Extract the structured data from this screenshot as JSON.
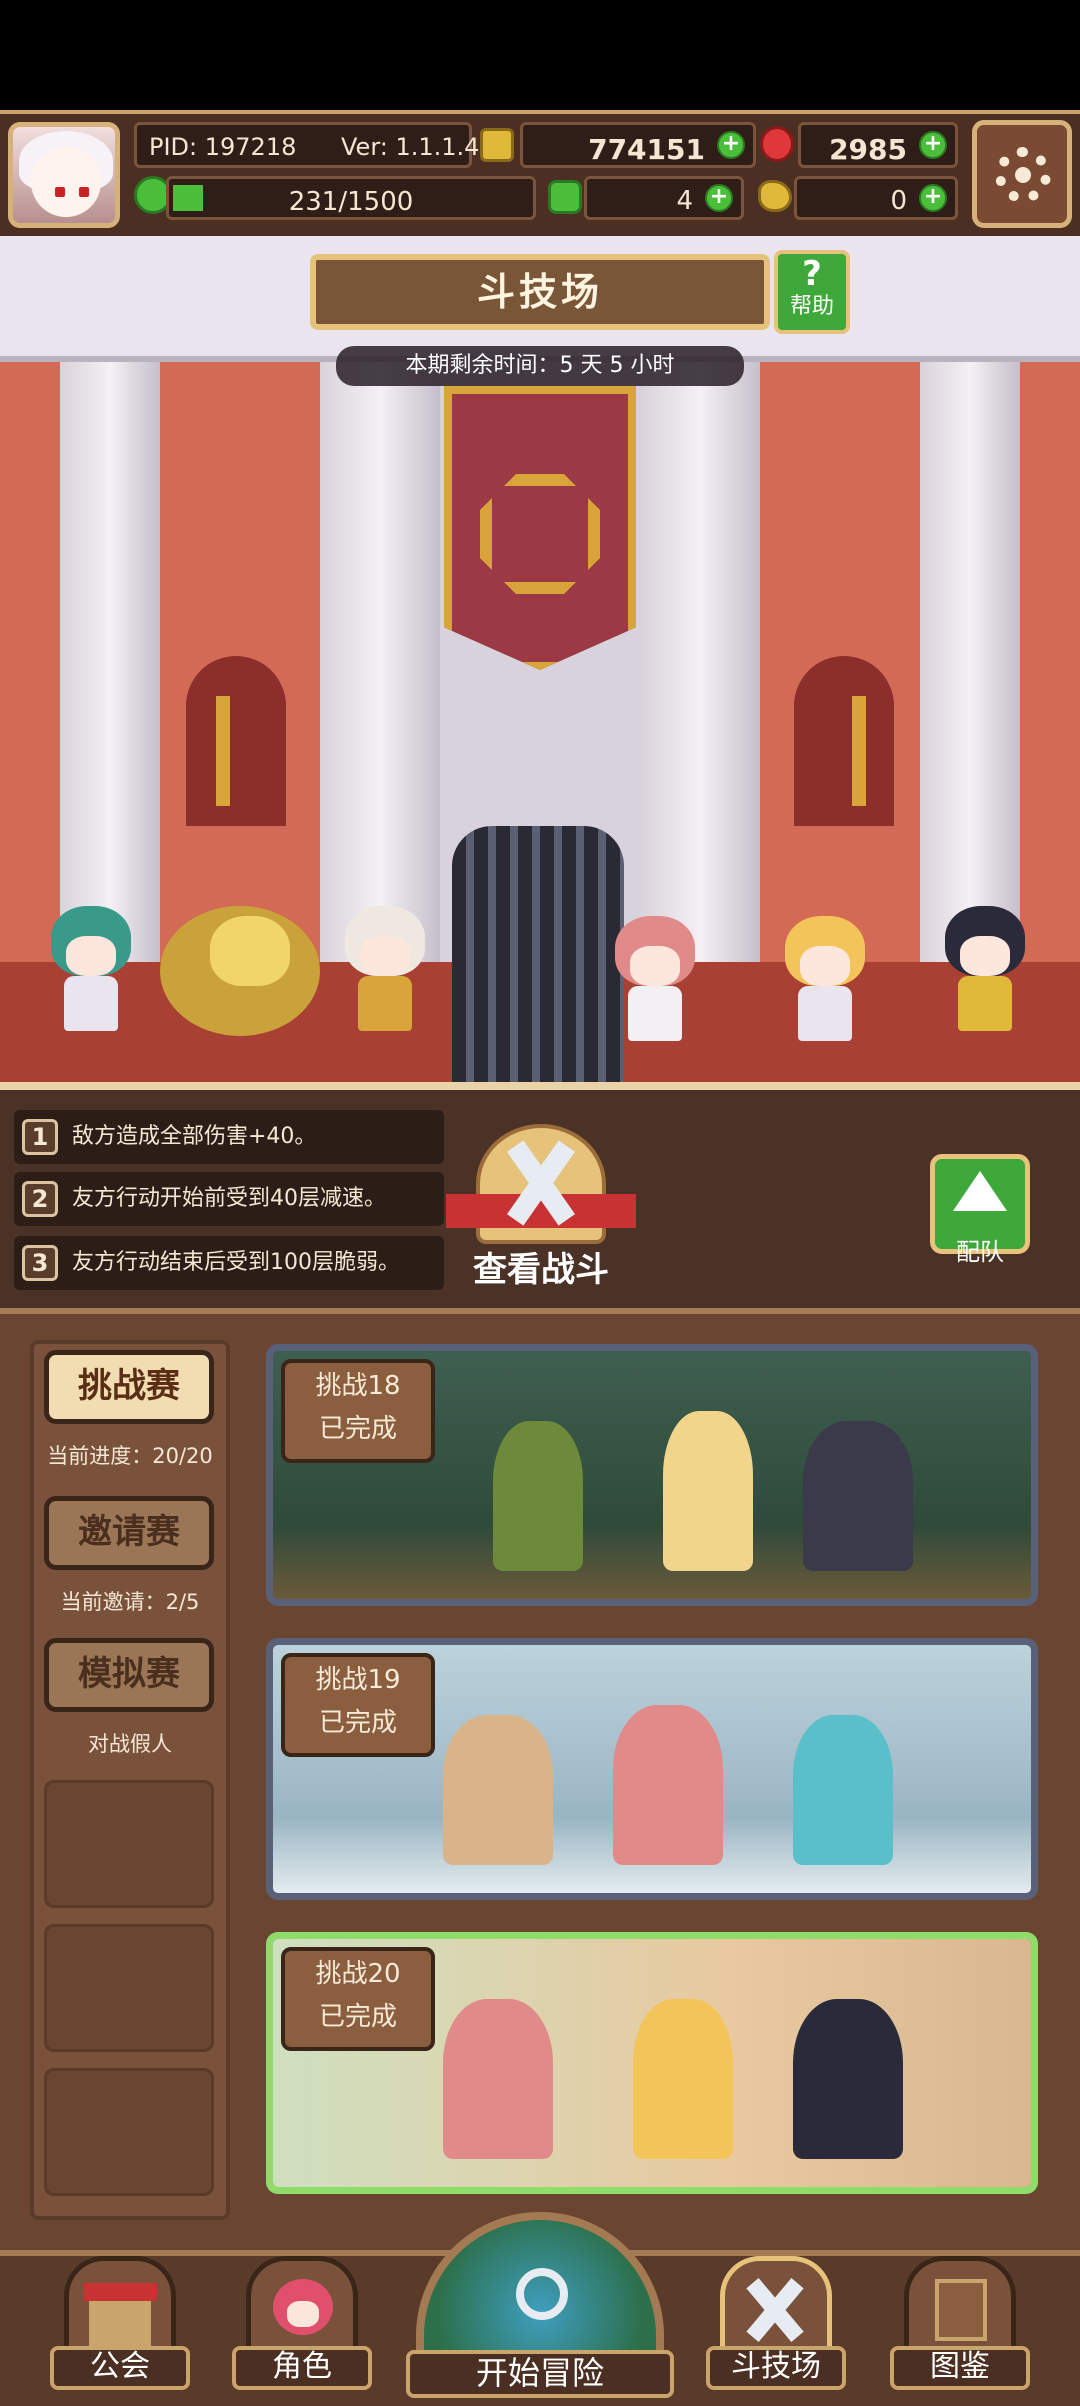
{
  "status": {
    "pid": "PID: 197218",
    "version": "Ver: 1.1.1.4",
    "gold": "774151",
    "gems": "2985",
    "stamina": "231/1500",
    "clover": "4",
    "chicken": "0"
  },
  "arena": {
    "title": "斗技场",
    "help_label": "帮助",
    "time_remaining": "本期剩余时间：5 天 5 小时"
  },
  "rules": [
    {
      "num": "1",
      "text": "敌方造成全部伤害+40。"
    },
    {
      "num": "2",
      "text": "友方行动开始前受到40层减速。"
    },
    {
      "num": "3",
      "text": "友方行动结束后受到100层脆弱。"
    }
  ],
  "view_battle_label": "查看战斗",
  "team_label": "配队",
  "modes": [
    {
      "label": "挑战赛",
      "sub": "当前进度：20/20"
    },
    {
      "label": "邀请赛",
      "sub": "当前邀请：2/5"
    },
    {
      "label": "模拟赛",
      "sub": "对战假人"
    }
  ],
  "challenges": [
    {
      "title": "挑战18",
      "status": "已完成"
    },
    {
      "title": "挑战19",
      "status": "已完成"
    },
    {
      "title": "挑战20",
      "status": "已完成"
    }
  ],
  "nav": {
    "guild": "公会",
    "character": "角色",
    "adventure": "开始冒险",
    "arena": "斗技场",
    "codex": "图鉴"
  },
  "colors": {
    "frame_gold": "#c9a46b",
    "panel_brown": "#4a2f22",
    "selected_green": "#8fdc6a",
    "plus_green": "#4bbf3a"
  }
}
